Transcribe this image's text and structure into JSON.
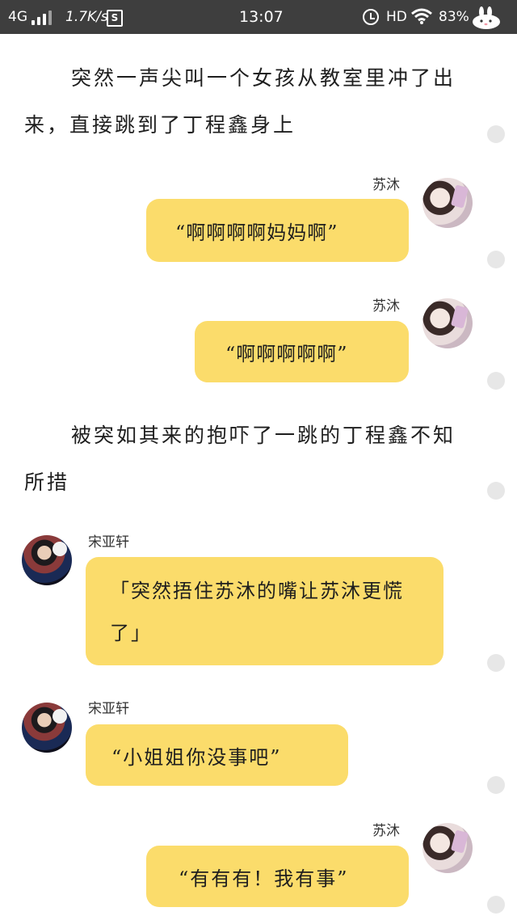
{
  "status_bar": {
    "network": "4G",
    "speed": "1.7K/s",
    "s_badge": "S",
    "time": "13:07",
    "hd": "HD",
    "battery": "83%"
  },
  "story": {
    "narration_1": "突然一声尖叫一个女孩从教室里冲了出来，直接跳到了丁程鑫身上",
    "message_1": {
      "name": "苏沐",
      "text": "“啊啊啊啊妈妈啊”"
    },
    "message_2": {
      "name": "苏沐",
      "text": "“啊啊啊啊啊”"
    },
    "narration_2": "被突如其来的抱吓了一跳的丁程鑫不知所措",
    "message_3": {
      "name": "宋亚轩",
      "text": "「突然捂住苏沐的嘴让苏沐更慌了」"
    },
    "message_4": {
      "name": "宋亚轩",
      "text": "“小姐姐你没事吧”"
    },
    "message_5": {
      "name": "苏沐",
      "text": "“有有有！我有事”"
    }
  }
}
